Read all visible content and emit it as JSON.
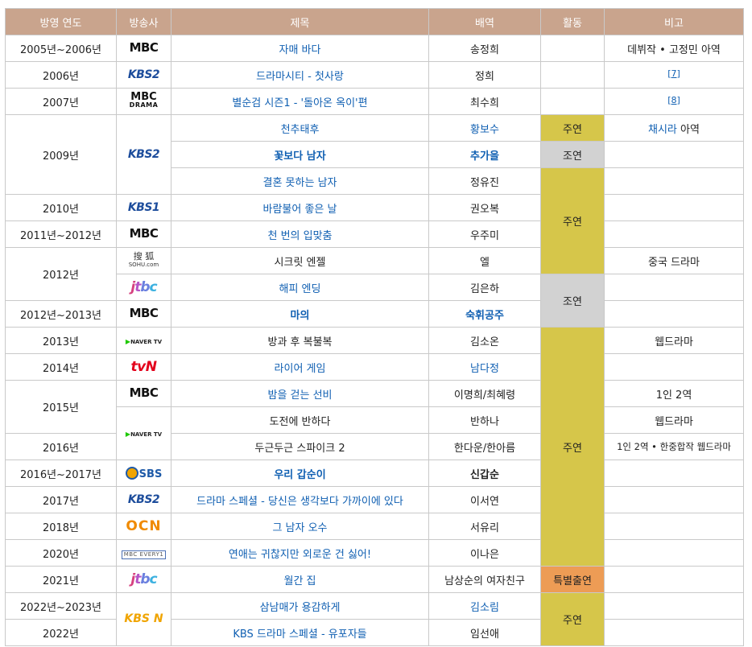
{
  "headers": {
    "year": "방영 연도",
    "broadcaster": "방송사",
    "title": "제목",
    "role": "배역",
    "activity": "활동",
    "note": "비고"
  },
  "logos": {
    "mbc": "MBC",
    "kbs2": "KBS2",
    "mbcdrama_top": "MBC",
    "mbcdrama_sub": "DRAMA",
    "kbs1": "KBS1",
    "sohu_top": "搜 狐",
    "sohu_sub": "SOHU.com",
    "jtbc_j": "j",
    "jtbc_t": "t",
    "jtbc_b": "b",
    "jtbc_c": "c",
    "naver": "NAVER TV",
    "tvn": "tvN",
    "sbs": "SBS",
    "ocn": "OCN",
    "mbcevery": "MBC EVERY1",
    "kbsn": "KBS N"
  },
  "icons": {
    "naver": "naver-tv-play-icon",
    "sbs": "sbs-circle-icon"
  },
  "colors": {
    "header_bg": "#c9a48d",
    "lead": "#d6c64a",
    "support": "#d2d2d2",
    "special": "#ed9c55",
    "link": "#0f5fb2"
  },
  "years": {
    "y1": "2005년~2006년",
    "y2": "2006년",
    "y3": "2007년",
    "y4": "2009년",
    "y5": "2010년",
    "y6": "2011년~2012년",
    "y7": "2012년",
    "y8": "2012년~2013년",
    "y9": "2013년",
    "y10": "2014년",
    "y11": "2015년",
    "y12": "2016년",
    "y13": "2016년~2017년",
    "y14": "2017년",
    "y15": "2018년",
    "y16": "2020년",
    "y17": "2021년",
    "y18": "2022년~2023년",
    "y19": "2022년"
  },
  "rows": [
    {
      "title": "자매 바다",
      "role": "송정희",
      "note": "데뷔작 • 고정민 아역"
    },
    {
      "title": "드라마시티 - 첫사랑",
      "role": "정희",
      "note": "[7]"
    },
    {
      "title": "별순검 시즌1 - '돌아온 옥이'편",
      "role": "최수희",
      "note": "[8]"
    },
    {
      "title": "천추태후",
      "role": "황보수",
      "note_link": "채시라",
      "note_rest": " 아역"
    },
    {
      "title": "꽃보다 남자",
      "role": "추가을",
      "note": ""
    },
    {
      "title": "결혼 못하는 남자",
      "role": "정유진",
      "note": ""
    },
    {
      "title": "바람불어 좋은 날",
      "role": "권오복",
      "note": ""
    },
    {
      "title": "천 번의 입맞춤",
      "role": "우주미",
      "note": ""
    },
    {
      "title": "시크릿 엔젤",
      "role": "엘",
      "note": "중국 드라마"
    },
    {
      "title": "해피 엔딩",
      "role": "김은하",
      "note": ""
    },
    {
      "title": "마의",
      "role": "숙휘공주",
      "note": ""
    },
    {
      "title": "방과 후 복불복",
      "role": "김소온",
      "note": "웹드라마"
    },
    {
      "title": "라이어 게임",
      "role": "남다정",
      "note": ""
    },
    {
      "title": "밤을 걷는 선비",
      "role": "이명희/최혜령",
      "note": "1인 2역"
    },
    {
      "title": "도전에 반하다",
      "role": "반하나",
      "note": "웹드라마"
    },
    {
      "title": "두근두근 스파이크 2",
      "role": "한다운/한아름",
      "note": "1인 2역 • 한중합작 웹드라마"
    },
    {
      "title": "우리 갑순이",
      "role": "신갑순",
      "note": ""
    },
    {
      "title": "드라마 스페셜 - 당신은 생각보다 가까이에 있다",
      "role": "이서연",
      "note": ""
    },
    {
      "title": "그 남자 오수",
      "role": "서유리",
      "note": ""
    },
    {
      "title": "연애는 귀찮지만 외로운 건 싫어!",
      "role": "이나은",
      "note": ""
    },
    {
      "title": "월간 집",
      "role": "남상순의 여자친구",
      "note": ""
    },
    {
      "title": "삼남매가 용감하게",
      "role": "김소림",
      "note": ""
    },
    {
      "title": "KBS 드라마 스페셜 - 유포자들",
      "role": "임선애",
      "note": ""
    }
  ],
  "activity": {
    "lead": "주연",
    "support": "조연",
    "special": "특별출연"
  }
}
